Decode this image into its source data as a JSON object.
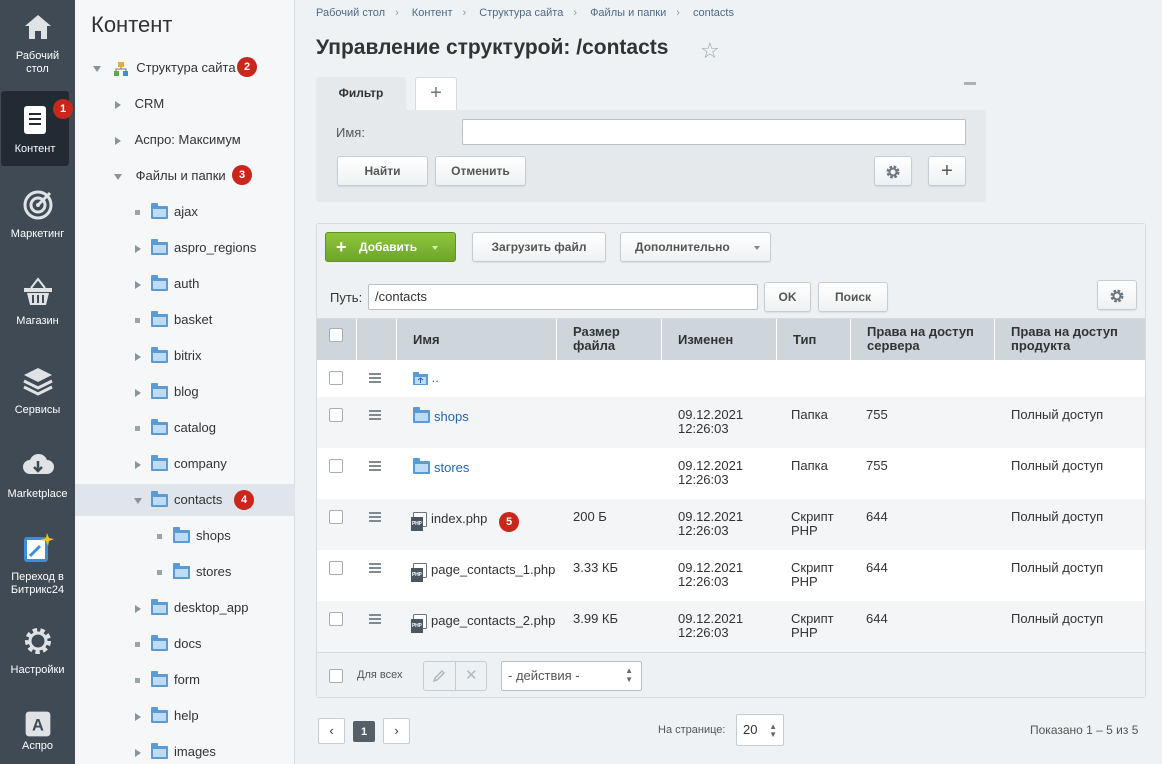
{
  "sidebar": {
    "items": [
      {
        "label": "Рабочий стол",
        "icon": "home-icon"
      },
      {
        "label": "Контент",
        "icon": "document-icon",
        "badge": "1"
      },
      {
        "label": "Маркетинг",
        "icon": "target-icon"
      },
      {
        "label": "Магазин",
        "icon": "basket-icon"
      },
      {
        "label": "Сервисы",
        "icon": "layers-icon"
      },
      {
        "label": "Marketplace",
        "icon": "cloud-download-icon"
      },
      {
        "label": "Переход в Битрикс24",
        "icon": "bitrix24-icon"
      },
      {
        "label": "Настройки",
        "icon": "gear-icon"
      },
      {
        "label": "Аспро",
        "icon": "aspro-icon"
      }
    ]
  },
  "tree": {
    "title": "Контент",
    "nodes": [
      {
        "label": "Структура сайта",
        "badge": "2"
      },
      {
        "label": "CRM"
      },
      {
        "label": "Аспро: Максимум"
      },
      {
        "label": "Файлы и папки",
        "badge": "3"
      },
      {
        "label": "ajax"
      },
      {
        "label": "aspro_regions"
      },
      {
        "label": "auth"
      },
      {
        "label": "basket"
      },
      {
        "label": "bitrix"
      },
      {
        "label": "blog"
      },
      {
        "label": "catalog"
      },
      {
        "label": "company"
      },
      {
        "label": "contacts",
        "badge": "4"
      },
      {
        "label": "shops"
      },
      {
        "label": "stores"
      },
      {
        "label": "desktop_app"
      },
      {
        "label": "docs"
      },
      {
        "label": "form"
      },
      {
        "label": "help"
      },
      {
        "label": "images"
      }
    ]
  },
  "breadcrumbs": [
    "Рабочий стол",
    "Контент",
    "Структура сайта",
    "Файлы и папки",
    "contacts"
  ],
  "page_title": "Управление структурой: /contacts",
  "filter": {
    "tab_label": "Фильтр",
    "add_tab": "+",
    "name_label": "Имя:",
    "name_value": "",
    "find_button": "Найти",
    "cancel_button": "Отменить",
    "add_button": "+"
  },
  "toolbar": {
    "add_button": "Добавить",
    "upload_button": "Загрузить файл",
    "more_button": "Дополнительно",
    "path_label": "Путь:",
    "path_value": "/contacts",
    "ok_button": "OK",
    "search_button": "Поиск"
  },
  "table": {
    "columns": [
      "Имя",
      "Размер файла",
      "Изменен",
      "Тип",
      "Права на доступ сервера",
      "Права на доступ продукта"
    ],
    "rows": [
      {
        "name": "..",
        "size": "",
        "date": "",
        "time": "",
        "type": "",
        "type2": "",
        "server": "",
        "product": "",
        "kind": "up"
      },
      {
        "name": "shops",
        "size": "",
        "date": "09.12.2021",
        "time": "12:26:03",
        "type": "Папка",
        "type2": "",
        "server": "755",
        "product": "Полный доступ",
        "kind": "folder"
      },
      {
        "name": "stores",
        "size": "",
        "date": "09.12.2021",
        "time": "12:26:03",
        "type": "Папка",
        "type2": "",
        "server": "755",
        "product": "Полный доступ",
        "kind": "folder"
      },
      {
        "name": "index.php",
        "size": "200 Б",
        "date": "09.12.2021",
        "time": "12:26:03",
        "type": "Скрипт",
        "type2": "PHP",
        "server": "644",
        "product": "Полный доступ",
        "kind": "php",
        "badge": "5"
      },
      {
        "name": "page_contacts_1.php",
        "size": "3.33 КБ",
        "date": "09.12.2021",
        "time": "12:26:03",
        "type": "Скрипт",
        "type2": "PHP",
        "server": "644",
        "product": "Полный доступ",
        "kind": "php"
      },
      {
        "name": "page_contacts_2.php",
        "size": "3.99 КБ",
        "date": "09.12.2021",
        "time": "12:26:03",
        "type": "Скрипт",
        "type2": "PHP",
        "server": "644",
        "product": "Полный доступ",
        "kind": "php"
      }
    ]
  },
  "footer": {
    "for_all_label": "Для всех",
    "actions_value": "- действия -"
  },
  "pagination": {
    "current_page": "1",
    "per_page_label": "На странице:",
    "per_page_value": "20",
    "shown_text": "Показано 1 – 5 из 5"
  }
}
